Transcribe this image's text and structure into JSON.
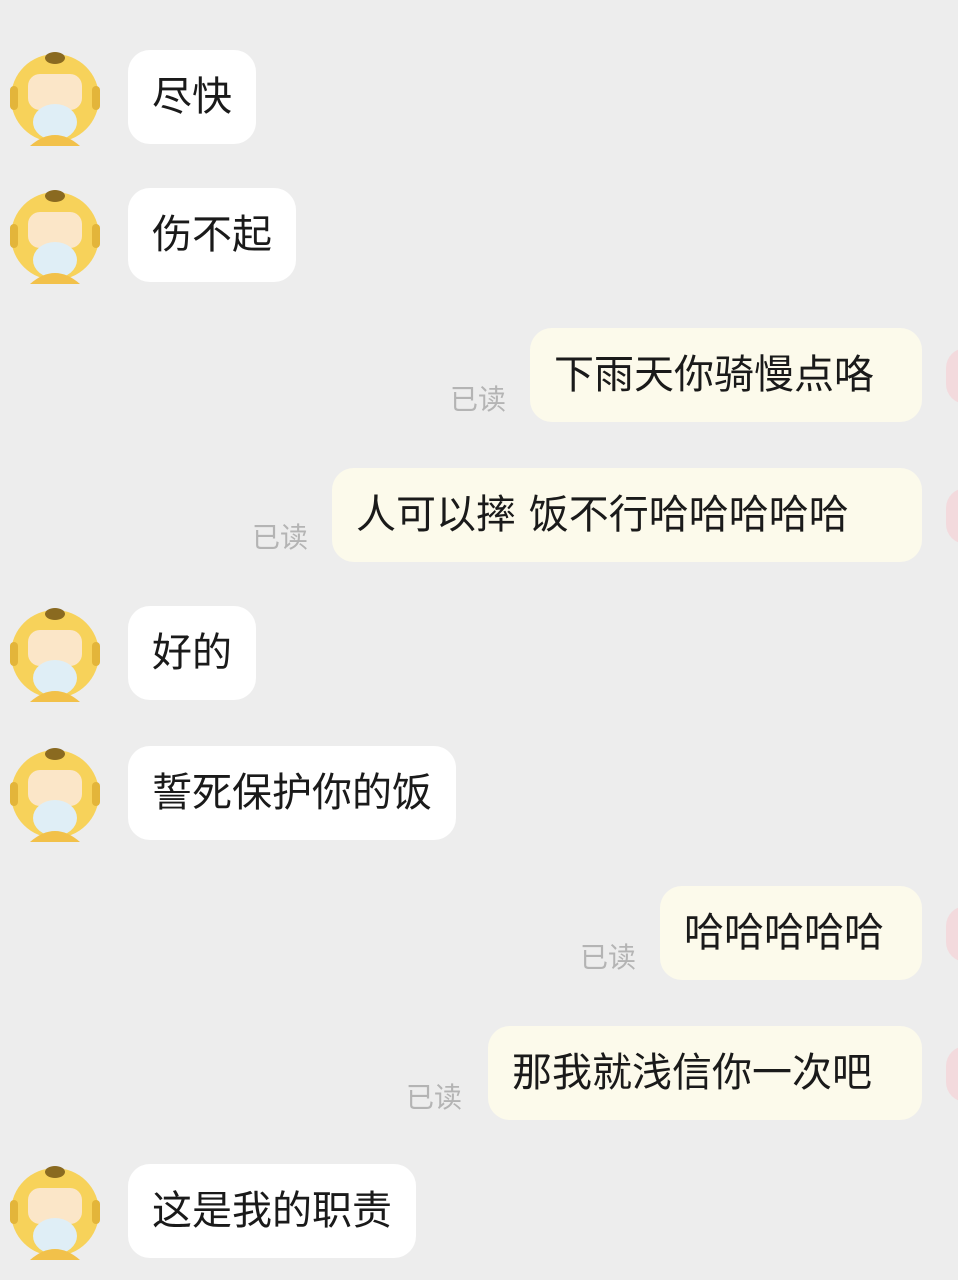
{
  "colors": {
    "background": "#ededed",
    "incoming_bubble": "#ffffff",
    "outgoing_bubble": "#fcfaeb",
    "read_receipt": "#b4b4b4",
    "avatar_helmet": "#f7d25a",
    "avatar_mask": "#dfeef6",
    "self_avatar": "#f3dadd"
  },
  "avatar_icon": "delivery-rider-helmet-icon",
  "messages": [
    {
      "side": "in",
      "text": "尽快"
    },
    {
      "side": "in",
      "text": "伤不起"
    },
    {
      "side": "out",
      "text": "下雨天你骑慢点咯",
      "status": "已读"
    },
    {
      "side": "out",
      "text": "人可以摔  饭不行哈哈哈哈哈",
      "status": "已读"
    },
    {
      "side": "in",
      "text": "好的"
    },
    {
      "side": "in",
      "text": "誓死保护你的饭"
    },
    {
      "side": "out",
      "text": "哈哈哈哈哈",
      "status": "已读"
    },
    {
      "side": "out",
      "text": "那我就浅信你一次吧",
      "status": "已读"
    },
    {
      "side": "in",
      "text": "这是我的职责"
    }
  ]
}
